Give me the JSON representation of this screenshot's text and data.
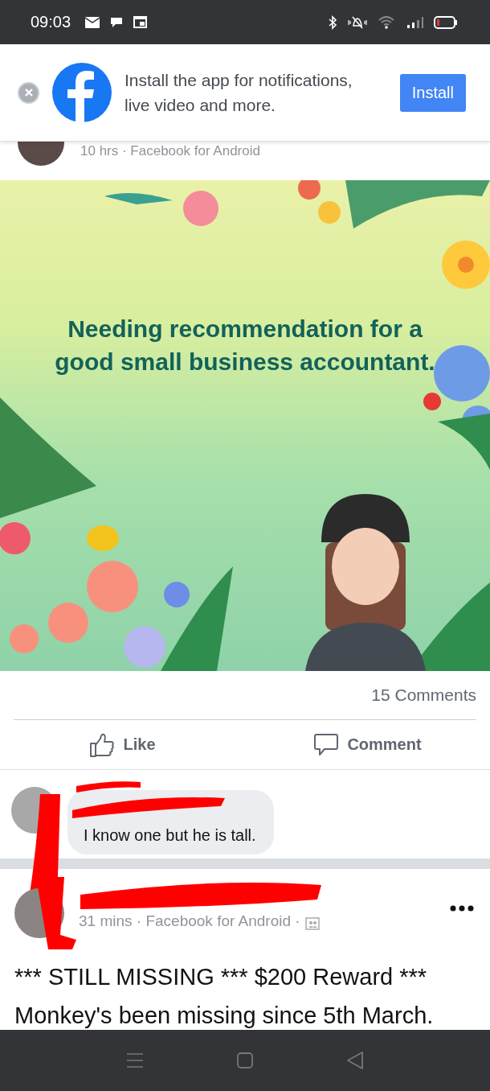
{
  "status_bar": {
    "time": "09:03"
  },
  "install_banner": {
    "text": "Install the app for notifications, live video and more.",
    "button": "Install"
  },
  "previous_post": {
    "meta": "10 hrs · Facebook for Android"
  },
  "post_card": {
    "text": "Needing recommendation for a good small business accountant."
  },
  "post_footer": {
    "comments_count": "15 Comments",
    "actions": [
      {
        "kind": "like",
        "label": "Like"
      },
      {
        "kind": "comment",
        "label": "Comment"
      }
    ]
  },
  "comment": {
    "text": "I know one but he is tall."
  },
  "next_post": {
    "meta": "31 mins · Facebook for Android ·",
    "lines": [
      "*** STILL MISSING *** $200 Reward ***",
      "Monkey's been missing since 5th March."
    ]
  }
}
